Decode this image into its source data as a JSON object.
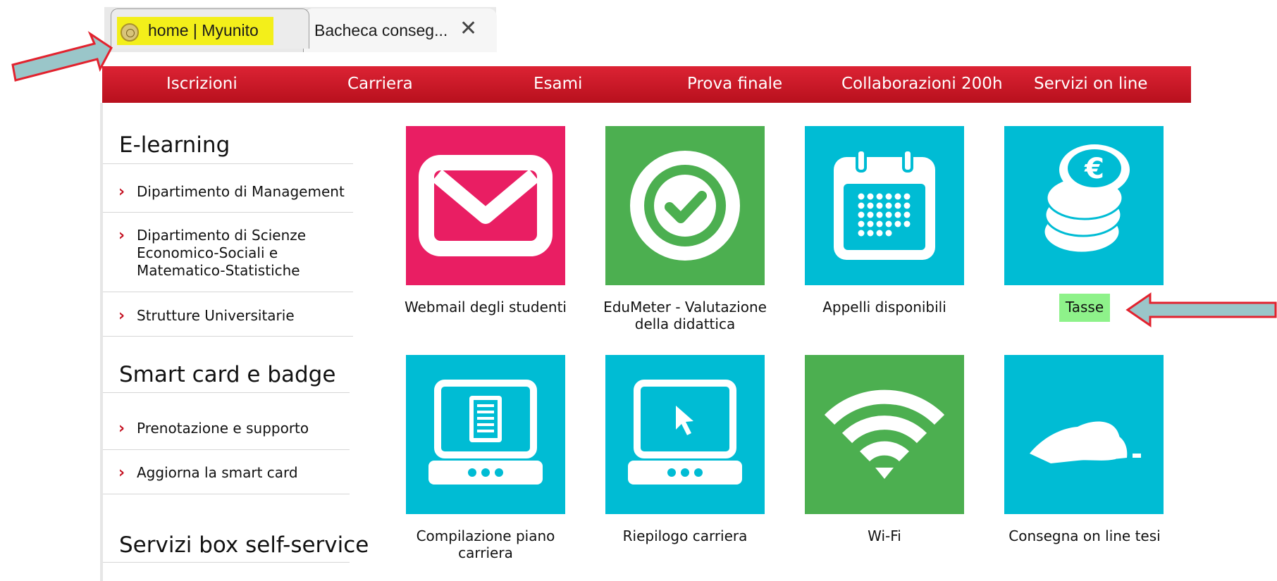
{
  "browser": {
    "tabs": [
      {
        "title": "home | Myunito",
        "active": true
      },
      {
        "title": "Bacheca conseg...",
        "close_icon": "close-icon"
      }
    ]
  },
  "nav": {
    "items": [
      "Iscrizioni",
      "Carriera",
      "Esami",
      "Prova finale",
      "Collaborazioni 200h",
      "Servizi on line"
    ]
  },
  "sidebar": {
    "sections": [
      {
        "title": "E-learning",
        "links": [
          "Dipartimento di Management",
          "Dipartimento di Scienze\nEconomico-Sociali e\nMatematico-Statistiche",
          "Strutture Universitarie"
        ]
      },
      {
        "title": "Smart card e badge",
        "links": [
          "Prenotazione e supporto",
          "Aggiorna la smart card"
        ]
      },
      {
        "title": "Servizi box self-service",
        "links": []
      }
    ]
  },
  "tiles": [
    {
      "label": "Webmail degli studenti",
      "icon": "envelope-icon",
      "color": "#e91e63"
    },
    {
      "label": "EduMeter - Valutazione\ndella didattica",
      "icon": "checkmark-icon",
      "color": "#4caf50"
    },
    {
      "label": "Appelli disponibili",
      "icon": "calendar-icon",
      "color": "#00bcd4"
    },
    {
      "label": "Tasse",
      "icon": "euro-coins-icon",
      "color": "#00bcd4",
      "highlighted": true
    },
    {
      "label": "Compilazione piano\ncarriera",
      "icon": "laptop-document-icon",
      "color": "#00bcd4"
    },
    {
      "label": "Riepilogo carriera",
      "icon": "laptop-cursor-icon",
      "color": "#00bcd4"
    },
    {
      "label": "Wi-Fi",
      "icon": "wifi-icon",
      "color": "#4caf50"
    },
    {
      "label": "Consegna on line tesi",
      "icon": "hand-mouse-icon",
      "color": "#00bcd4"
    }
  ],
  "colors": {
    "nav_red": "#c8151f",
    "highlight_yellow": "#f3ef1a",
    "highlight_green": "#8ef28a",
    "arrow": "#9ac6c9"
  }
}
